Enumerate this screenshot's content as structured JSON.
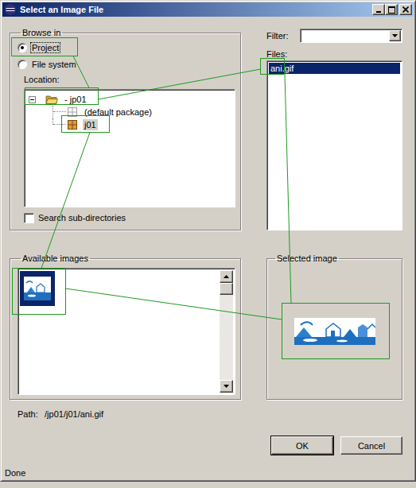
{
  "window": {
    "title": "Select an Image File"
  },
  "browse_in": {
    "label": "Browse in",
    "options": [
      {
        "label": "Project",
        "selected": true
      },
      {
        "label": "File system",
        "selected": false
      }
    ]
  },
  "location": {
    "label": "Location:",
    "tree": [
      {
        "label": "- jp01",
        "kind": "project",
        "expanded": true,
        "selected": false,
        "children": [
          {
            "label": "(default package)",
            "kind": "empty-package",
            "selected": false
          },
          {
            "label": "j01",
            "kind": "package",
            "selected": true
          }
        ]
      }
    ]
  },
  "search_subdirectories": {
    "label": "Search sub-directories",
    "checked": false
  },
  "filter": {
    "label": "Filter:",
    "value": ""
  },
  "files": {
    "label": "Files:",
    "items": [
      {
        "name": "ani.gif",
        "selected": true
      }
    ]
  },
  "available_images": {
    "label": "Available images",
    "items": [
      {
        "selected": true
      }
    ]
  },
  "selected_image": {
    "label": "Selected image"
  },
  "path": {
    "label": "Path:",
    "value": "/jp01/j01/ani.gif"
  },
  "buttons": [
    {
      "label": "OK",
      "default": true
    },
    {
      "label": "Cancel",
      "default": false
    }
  ],
  "status_bar": {
    "text": "Done"
  }
}
